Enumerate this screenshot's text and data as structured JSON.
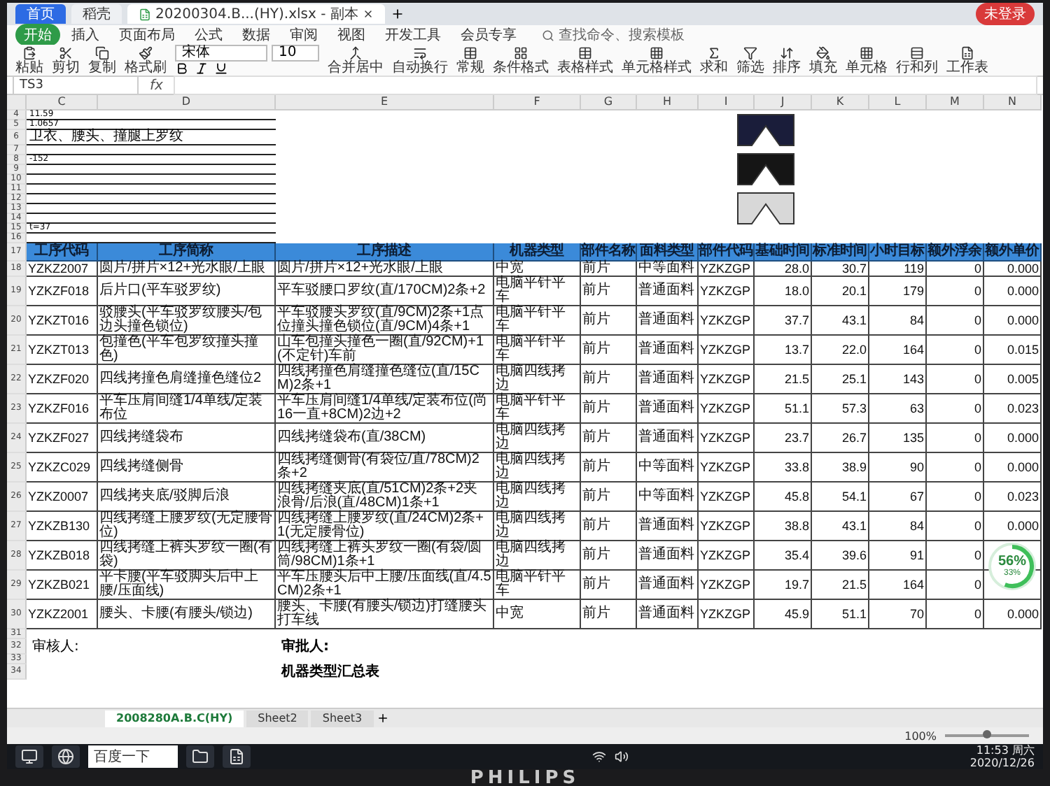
{
  "tabs": [
    {
      "label": "首页",
      "kind": "home",
      "selected": false
    },
    {
      "label": "稻壳",
      "kind": "docer",
      "selected": false
    },
    {
      "label": "20200304.B...(HY).xlsx - 副本",
      "kind": "file",
      "selected": true
    }
  ],
  "login": "未登录",
  "menu": [
    {
      "label": "开始",
      "selected": true
    },
    {
      "label": "插入",
      "selected": false
    },
    {
      "label": "页面布局",
      "selected": false
    },
    {
      "label": "公式",
      "selected": false
    },
    {
      "label": "数据",
      "selected": false
    },
    {
      "label": "审阅",
      "selected": false
    },
    {
      "label": "视图",
      "selected": false
    },
    {
      "label": "开发工具",
      "selected": false
    },
    {
      "label": "会员专享",
      "selected": false
    }
  ],
  "search": {
    "placeholder": "查找命令、搜索模板"
  },
  "clipboard": [
    "粘贴",
    "剪切",
    "复制",
    "格式刷"
  ],
  "font": {
    "name": "宋体",
    "size": "10"
  },
  "tools": [
    "合并居中",
    "自动换行",
    "常规",
    "条件格式",
    "表格样式",
    "单元格样式",
    "求和",
    "筛选",
    "排序",
    "填充",
    "单元格",
    "行和列",
    "工作表"
  ],
  "name_box": "TS3",
  "formula_label": "fx",
  "columns": [
    "C",
    "D",
    "E",
    "F",
    "G",
    "H",
    "I",
    "J",
    "K",
    "L",
    "M",
    "N"
  ],
  "top_rows": [
    {
      "number": "4",
      "text": "11.59"
    },
    {
      "number": "5",
      "text": "1.0657"
    },
    {
      "number": "6",
      "text": "卫衣、腰头、撞腿上罗纹"
    },
    {
      "number": "7",
      "text": ""
    },
    {
      "number": "8",
      "text": "-152"
    },
    {
      "number": "9",
      "text": ""
    },
    {
      "number": "10",
      "text": ""
    },
    {
      "number": "11",
      "text": ""
    },
    {
      "number": "12",
      "text": ""
    },
    {
      "number": "13",
      "text": ""
    },
    {
      "number": "14",
      "text": ""
    },
    {
      "number": "15",
      "text": "t=37"
    },
    {
      "number": "16",
      "text": ""
    }
  ],
  "header": {
    "number": "17",
    "cells": [
      "工序代码",
      "工序简称",
      "工序描述",
      "机器类型",
      "部件名称",
      "面料类型",
      "部件代码",
      "基础时间",
      "标准时间",
      "小时目标",
      "额外浮余",
      "额外单价"
    ]
  },
  "rows": [
    {
      "number": "18",
      "cells": [
        "YZKZ2007",
        "圆片/拼片×12+光水眼/上眼",
        "圆片/拼片×12+光水眼/上眼",
        "中宽",
        "前片",
        "中等面料",
        "YZKZGP",
        "28.0",
        "30.7",
        "119",
        "0",
        "0.000"
      ]
    },
    {
      "number": "19",
      "cells": [
        "YZKZF018",
        "后片口(平车驳罗纹)",
        "平车驳腰口罗纹(直/170CM)2条+2",
        "电脑平针平车",
        "前片",
        "普通面料",
        "YZKZGP",
        "18.0",
        "20.1",
        "179",
        "0",
        "0.000"
      ]
    },
    {
      "number": "20",
      "cells": [
        "YZKZT016",
        "驳腰头(平车驳罗纹腰头/包边头撞色锁位)",
        "平车驳腰头罗纹(直/9CM)2条+1点位撞头撞色锁位(直/9CM)4条+1",
        "电脑平针平车",
        "前片",
        "普通面料",
        "YZKZGP",
        "37.7",
        "43.1",
        "84",
        "0",
        "0.000"
      ]
    },
    {
      "number": "21",
      "cells": [
        "YZKZT013",
        "包撞色(平车包罗纹撞头撞色)",
        "山车包撞头撞色一圈(直/92CM)+1(不定针)车前",
        "电脑平针平车",
        "前片",
        "普通面料",
        "YZKZGP",
        "13.7",
        "22.0",
        "164",
        "0",
        "0.015"
      ]
    },
    {
      "number": "22",
      "cells": [
        "YZKZF020",
        "四线拷撞色肩缝撞色缝位2",
        "四线拷撞色肩缝撞色缝位(直/15CM)2条+1",
        "电脑四线拷边",
        "前片",
        "普通面料",
        "YZKZGP",
        "21.5",
        "25.1",
        "143",
        "0",
        "0.005"
      ]
    },
    {
      "number": "23",
      "cells": [
        "YZKZF016",
        "平车压肩间缝1/4单线/定装布位",
        "平车压肩间缝1/4单线/定装布位(尚16一直+8CM)2边+2",
        "电脑平针平车",
        "前片",
        "普通面料",
        "YZKZGP",
        "51.1",
        "57.3",
        "63",
        "0",
        "0.023"
      ]
    },
    {
      "number": "24",
      "cells": [
        "YZKZF027",
        "四线拷缝袋布",
        "四线拷缝袋布(直/38CM)",
        "电脑四线拷边",
        "前片",
        "普通面料",
        "YZKZGP",
        "23.7",
        "26.7",
        "135",
        "0",
        "0.000"
      ]
    },
    {
      "number": "25",
      "cells": [
        "YZKZC029",
        "四线拷缝侧骨",
        "四线拷缝侧骨(有袋位/直/78CM)2条+2",
        "电脑四线拷边",
        "前片",
        "中等面料",
        "YZKZGP",
        "33.8",
        "38.9",
        "90",
        "0",
        "0.000"
      ]
    },
    {
      "number": "26",
      "cells": [
        "YZKZ0007",
        "四线拷夹底/驳脚后浪",
        "四线拷缝夹底(直/51CM)2条+2夹浪骨/后浪(直/48CM)1条+1",
        "电脑四线拷边",
        "前片",
        "中等面料",
        "YZKZGP",
        "45.8",
        "54.1",
        "67",
        "0",
        "0.023"
      ]
    },
    {
      "number": "27",
      "cells": [
        "YZKZB130",
        "四线拷缝上腰罗纹(无定腰骨位)",
        "四线拷缝上腰罗纹(直/24CM)2条+1(无定腰骨位)",
        "电脑四线拷边",
        "前片",
        "普通面料",
        "YZKZGP",
        "38.8",
        "43.1",
        "84",
        "0",
        "0.000"
      ]
    },
    {
      "number": "28",
      "cells": [
        "YZKZB018",
        "四线拷缝上裤头罗纹一圈(有袋)",
        "四线拷缝上裤头罗纹一圈(有袋/圆筒/98CM)1条+1",
        "电脑四线拷边",
        "前片",
        "普通面料",
        "YZKZGP",
        "35.4",
        "39.6",
        "91",
        "0",
        ""
      ]
    },
    {
      "number": "29",
      "cells": [
        "YZKZB021",
        "平卡腰(平车驳脚头后中上腰/压面线)",
        "平车压腰头后中上腰/压面线(直/4.5CM)2条+1",
        "电脑平针平车",
        "前片",
        "普通面料",
        "YZKZGP",
        "19.7",
        "21.5",
        "164",
        "0",
        ""
      ]
    },
    {
      "number": "30",
      "cells": [
        "YZKZ2001",
        "腰头、卡腰(有腰头/锁边)",
        "腰头、卡腰(有腰头/锁边)打缝腰头打车线",
        "中宽",
        "前片",
        "普通面料",
        "YZKZGP",
        "45.9",
        "51.1",
        "70",
        "0",
        "0.000"
      ]
    }
  ],
  "footer_rows": [
    {
      "number": "31",
      "left": "",
      "right": ""
    },
    {
      "number": "32",
      "left": "审核人:",
      "right": "审批人:"
    },
    {
      "number": "33",
      "left": "",
      "right": ""
    },
    {
      "number": "34",
      "left": "",
      "right": "机器类型汇总表"
    }
  ],
  "sheet_tabs": [
    {
      "label": "2008280A.B.C(HY)",
      "selected": true
    },
    {
      "label": "Sheet2",
      "selected": false
    },
    {
      "label": "Sheet3",
      "selected": false
    }
  ],
  "zoom": {
    "label": "100%",
    "level": 0.5
  },
  "progress_widget": {
    "value": "56%",
    "detail": "33%",
    "level": 0.56
  },
  "taskbar": {
    "search": "百度一下",
    "time": "11:53 周六",
    "date": "2020/12/26"
  },
  "monitor": {
    "brand": "PHILIPS"
  }
}
